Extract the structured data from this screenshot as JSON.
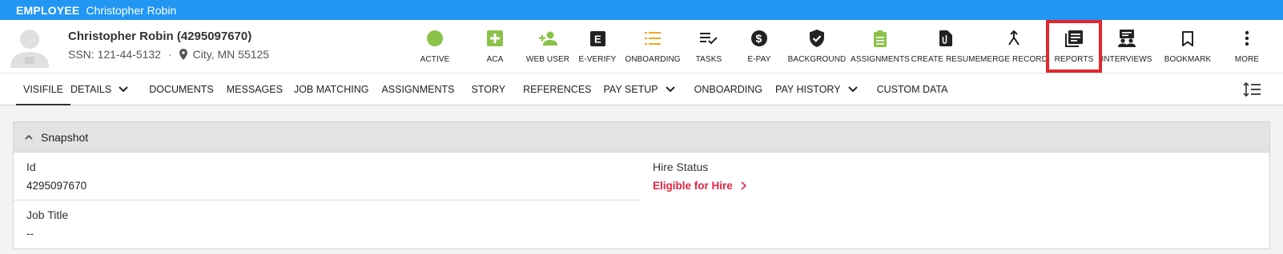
{
  "topbar": {
    "label": "EMPLOYEE",
    "name": "Christopher Robin"
  },
  "employee": {
    "title": "Christopher Robin (4295097670)",
    "ssn": "SSN: 121-44-5132",
    "dot": "·",
    "location": "City, MN 55125"
  },
  "actions": [
    {
      "label": "ACTIVE",
      "icon": "active-status-icon",
      "color": "#8bc34a"
    },
    {
      "label": "ACA",
      "icon": "aca-plus-icon",
      "color": "#8bc34a"
    },
    {
      "label": "WEB USER",
      "icon": "add-user-icon",
      "color": "#8bc34a"
    },
    {
      "label": "E-VERIFY",
      "icon": "e-verify-icon",
      "color": "#222222"
    },
    {
      "label": "ONBOARDING",
      "icon": "onboarding-list-icon",
      "color": "#f5a623"
    },
    {
      "label": "TASKS",
      "icon": "tasks-icon",
      "color": "#222222"
    },
    {
      "label": "E-PAY",
      "icon": "dollar-icon",
      "color": "#222222"
    },
    {
      "label": "BACKGROUND",
      "icon": "shield-check-icon",
      "color": "#222222"
    },
    {
      "label": "ASSIGNMENTS",
      "icon": "clipboard-icon",
      "color": "#8bc34a"
    },
    {
      "label": "CREATE RESUME",
      "icon": "attachment-doc-icon",
      "color": "#222222"
    },
    {
      "label": "MERGE RECORD",
      "icon": "merge-icon",
      "color": "#222222"
    },
    {
      "label": "REPORTS",
      "icon": "reports-icon",
      "color": "#222222"
    },
    {
      "label": "INTERVIEWS",
      "icon": "interviews-icon",
      "color": "#222222"
    },
    {
      "label": "BOOKMARK",
      "icon": "bookmark-icon",
      "color": "#222222"
    },
    {
      "label": "MORE",
      "icon": "more-vertical-icon",
      "color": "#222222"
    }
  ],
  "nav": [
    {
      "label": "VISIFILE",
      "active": true,
      "dropdown": false
    },
    {
      "label": "DETAILS",
      "active": false,
      "dropdown": true
    },
    {
      "label": "DOCUMENTS",
      "active": false,
      "dropdown": false
    },
    {
      "label": "MESSAGES",
      "active": false,
      "dropdown": false
    },
    {
      "label": "JOB MATCHING",
      "active": false,
      "dropdown": false
    },
    {
      "label": "ASSIGNMENTS",
      "active": false,
      "dropdown": false
    },
    {
      "label": "STORY",
      "active": false,
      "dropdown": false
    },
    {
      "label": "REFERENCES",
      "active": false,
      "dropdown": false
    },
    {
      "label": "PAY SETUP",
      "active": false,
      "dropdown": true
    },
    {
      "label": "ONBOARDING",
      "active": false,
      "dropdown": false
    },
    {
      "label": "PAY HISTORY",
      "active": false,
      "dropdown": true
    },
    {
      "label": "CUSTOM DATA",
      "active": false,
      "dropdown": false
    }
  ],
  "snapshot": {
    "title": "Snapshot",
    "id_label": "Id",
    "id_value": "4295097670",
    "hire_label": "Hire Status",
    "hire_value": "Eligible for Hire",
    "job_label": "Job Title",
    "job_value": "--"
  },
  "colors": {
    "brand": "#2196f3",
    "highlight": "#e5262d",
    "link": "#e8223f",
    "green": "#8bc34a",
    "orange": "#f5a623"
  }
}
